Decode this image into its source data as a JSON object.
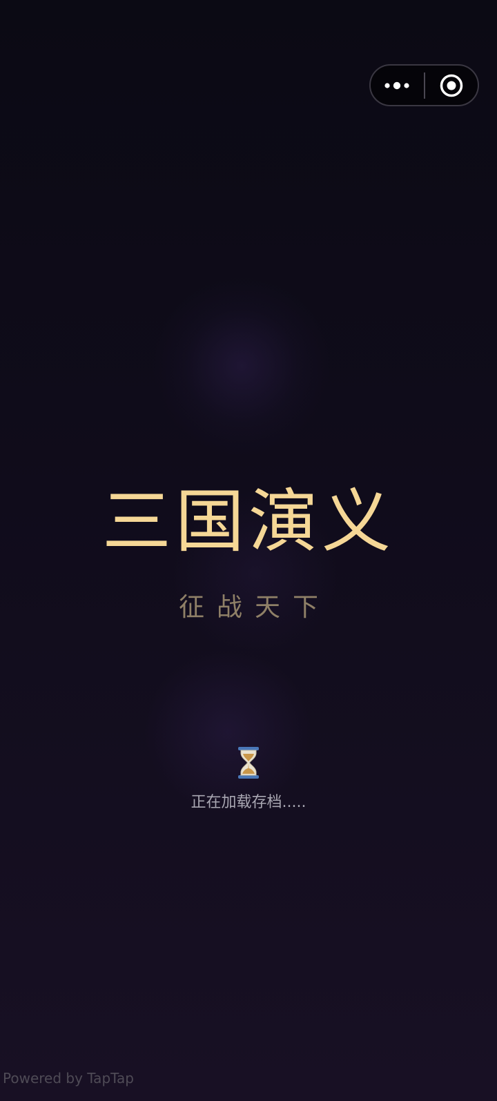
{
  "app": {
    "title": "三国演义",
    "subtitle": "征战天下"
  },
  "loading": {
    "icon": "hourglass-icon",
    "text": "正在加载存档....."
  },
  "capsule": {
    "more_icon": "more-dots-icon",
    "close_icon": "target-circle-icon"
  },
  "footer": {
    "powered_by": "Powered by TapTap"
  },
  "colors": {
    "title": "#f5d796",
    "subtitle": "#8f8067",
    "background_top": "#0b0a14",
    "background_bottom": "#181024",
    "loading_text": "#a9a7b2",
    "footer_text": "#4f4b56"
  }
}
